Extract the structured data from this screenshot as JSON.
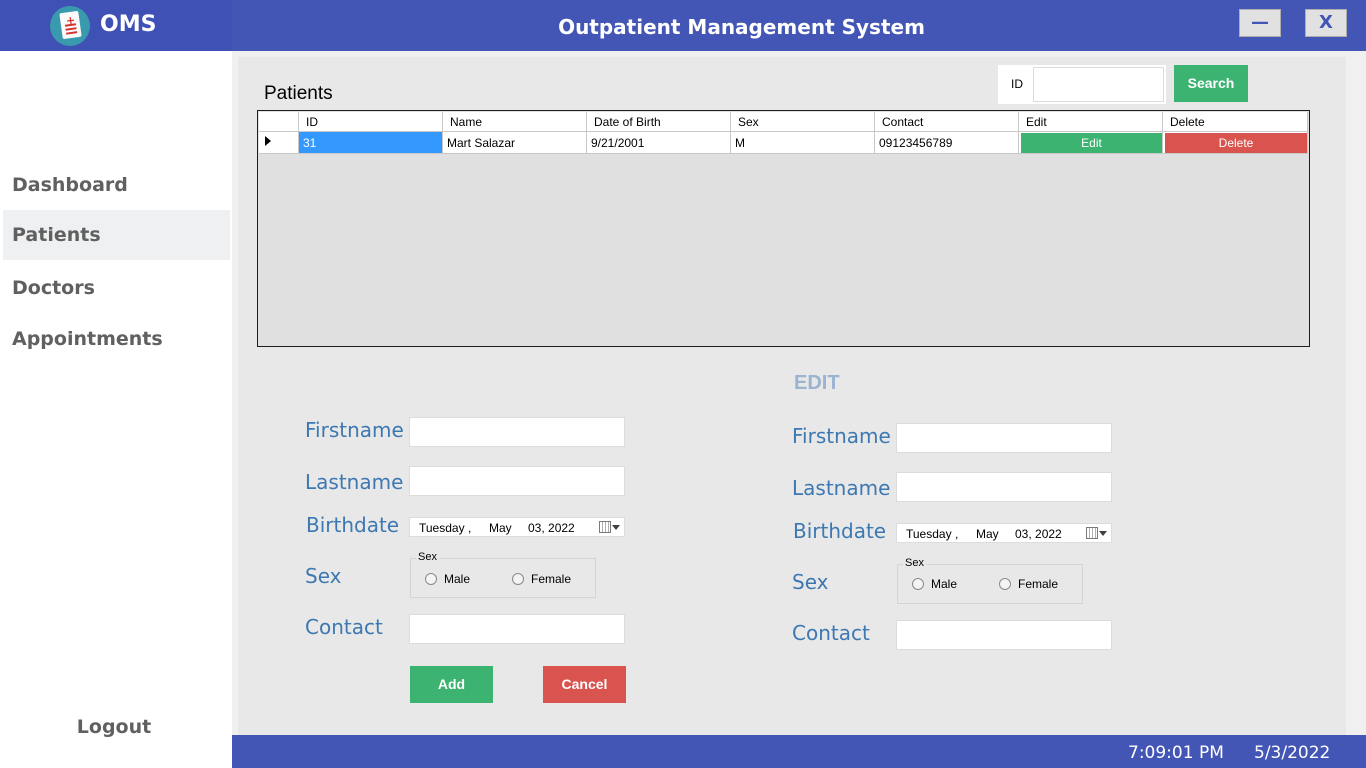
{
  "app": {
    "short_name": "OMS",
    "title": "Outpatient Management System",
    "minimize_label": "—",
    "close_label": "X",
    "brand_color": "#4355b5"
  },
  "sidebar": {
    "items": [
      {
        "label": "Dashboard",
        "active": false
      },
      {
        "label": "Patients",
        "active": true
      },
      {
        "label": "Doctors",
        "active": false
      },
      {
        "label": "Appointments",
        "active": false
      }
    ],
    "logout_label": "Logout"
  },
  "patients": {
    "heading": "Patients",
    "search": {
      "id_label": "ID",
      "value": "",
      "button_label": "Search"
    },
    "grid": {
      "columns": [
        "ID",
        "Name",
        "Date of Birth",
        "Sex",
        "Contact",
        "Edit",
        "Delete"
      ],
      "rows": [
        {
          "id": "31",
          "name": "Mart Salazar",
          "dob": "9/21/2001",
          "sex": "M",
          "contact": "09123456789",
          "edit_label": "Edit",
          "delete_label": "Delete"
        }
      ]
    }
  },
  "add_form": {
    "firstname_label": "Firstname",
    "lastname_label": "Lastname",
    "birthdate_label": "Birthdate",
    "sex_label": "Sex",
    "contact_label": "Contact",
    "firstname_value": "",
    "lastname_value": "",
    "contact_value": "",
    "date": {
      "weekday": "Tuesday",
      "comma": ",",
      "month": "May",
      "day_year": "03, 2022"
    },
    "sex_group_title": "Sex",
    "male_label": "Male",
    "female_label": "Female",
    "add_label": "Add",
    "cancel_label": "Cancel"
  },
  "edit_form": {
    "heading": "EDIT",
    "firstname_label": "Firstname",
    "lastname_label": "Lastname",
    "birthdate_label": "Birthdate",
    "sex_label": "Sex",
    "contact_label": "Contact",
    "firstname_value": "",
    "lastname_value": "",
    "contact_value": "",
    "date": {
      "weekday": "Tuesday",
      "comma": ",",
      "month": "May",
      "day_year": "03, 2022"
    },
    "sex_group_title": "Sex",
    "male_label": "Male",
    "female_label": "Female"
  },
  "status": {
    "time": "7:09:01 PM",
    "date": "5/3/2022"
  },
  "colors": {
    "accent_green": "#3cb371",
    "accent_red": "#d9534f",
    "label_blue": "#3d78b2",
    "selection_blue": "#3399ff"
  }
}
